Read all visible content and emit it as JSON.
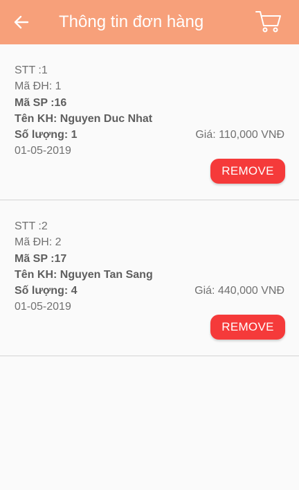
{
  "header": {
    "title": "Thông tin đơn hàng",
    "back_icon": "arrow-left-icon",
    "cart_icon": "shopping-cart-icon",
    "background_color": "#f7a07a"
  },
  "orders": [
    {
      "stt": "STT :1",
      "ma_dh": "Mã ĐH: 1",
      "ma_sp": "Mã SP :16",
      "ten_kh": "Tên KH: Nguyen Duc Nhat",
      "so_luong": "Số lượng: 1",
      "gia": "Giá: 110,000 VNĐ",
      "date": "01-05-2019",
      "remove_label": "REMOVE"
    },
    {
      "stt": "STT :2",
      "ma_dh": "Mã ĐH: 2",
      "ma_sp": "Mã SP :17",
      "ten_kh": "Tên KH: Nguyen Tan Sang",
      "so_luong": "Số lượng: 4",
      "gia": "Giá: 440,000 VNĐ",
      "date": "01-05-2019",
      "remove_label": "REMOVE"
    }
  ],
  "colors": {
    "remove_button": "#f53a3a"
  }
}
